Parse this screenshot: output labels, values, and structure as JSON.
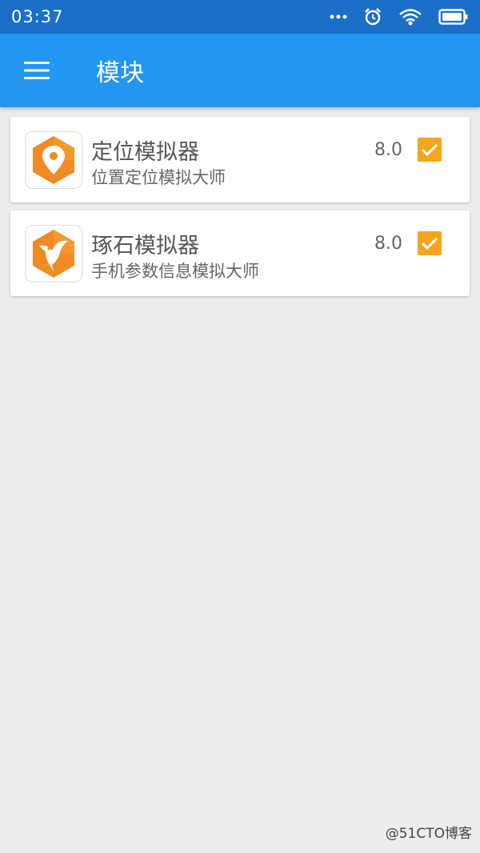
{
  "status_bar": {
    "time": "03:37"
  },
  "app_bar": {
    "title": "模块"
  },
  "modules": [
    {
      "name": "定位模拟器",
      "description": "位置定位模拟大师",
      "version": "8.0",
      "enabled": true,
      "icon": "location-pin-icon"
    },
    {
      "name": "琢石模拟器",
      "description": "手机参数信息模拟大师",
      "version": "8.0",
      "enabled": true,
      "icon": "bird-icon"
    }
  ],
  "watermark": "@51CTO博客",
  "colors": {
    "status_bar": "#1b6fc7",
    "app_bar": "#2196f3",
    "accent": "#f7a51b",
    "background": "#ededed"
  }
}
